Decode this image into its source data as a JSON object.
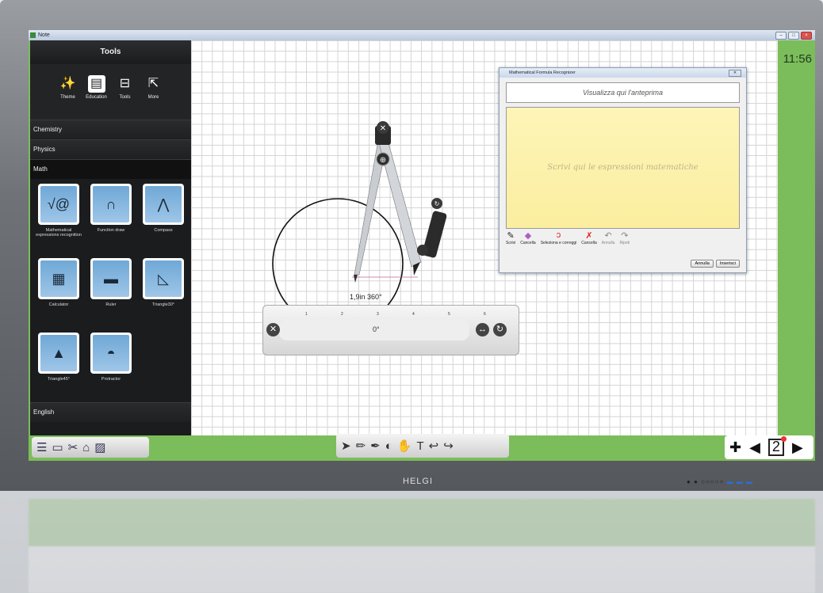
{
  "window": {
    "title": "Note",
    "controls": [
      "–",
      "□",
      "×"
    ]
  },
  "clock": "11:56",
  "sidebar": {
    "title": "Tools",
    "tabs": [
      {
        "label": "Theme",
        "icon": "magic-wand-icon"
      },
      {
        "label": "Education",
        "icon": "book-icon",
        "active": true
      },
      {
        "label": "Tools",
        "icon": "toolbox-icon"
      },
      {
        "label": "More",
        "icon": "external-link-icon"
      }
    ],
    "categories": [
      "Chemistry",
      "Physics",
      "Math",
      "English"
    ],
    "math_tools": [
      {
        "label": "Mathematical expressions recognition",
        "icon": "formula-icon"
      },
      {
        "label": "Function draw",
        "icon": "function-graph-icon"
      },
      {
        "label": "Compass",
        "icon": "compass-icon"
      },
      {
        "label": "Calculator",
        "icon": "calculator-icon"
      },
      {
        "label": "Ruler",
        "icon": "ruler-icon"
      },
      {
        "label": "Triangle30°",
        "icon": "triangle-30-icon"
      },
      {
        "label": "Triangle45°",
        "icon": "triangle-45-icon"
      },
      {
        "label": "Protractor",
        "icon": "protractor-icon"
      }
    ]
  },
  "formula_dialog": {
    "title": "Mathematical Formula Recognizer",
    "preview_placeholder": "Visualizza qui l'anteprima",
    "write_placeholder": "Scrivi qui le espressioni matematiche",
    "tools": [
      {
        "label": "Scrivi",
        "icon": "pen-icon"
      },
      {
        "label": "Cancella",
        "icon": "eraser-icon"
      },
      {
        "label": "Seleziona e correggi",
        "icon": "lasso-icon"
      },
      {
        "label": "Cancella",
        "icon": "clear-x-icon"
      },
      {
        "label": "Annulla",
        "icon": "undo-icon"
      },
      {
        "label": "Ripeti",
        "icon": "redo-icon"
      }
    ],
    "buttons": {
      "cancel": "Annulla",
      "insert": "Inserisci"
    }
  },
  "ruler": {
    "ticks": [
      "1",
      "2",
      "3",
      "4",
      "5",
      "6"
    ],
    "angle": "0°"
  },
  "compass_measure": "1,9in 360°",
  "page_indicator": "2",
  "bezel_brand": "HELGI",
  "colors": {
    "accent_green": "#7bbd5a",
    "sidebar_bg": "#1b1c1e"
  }
}
